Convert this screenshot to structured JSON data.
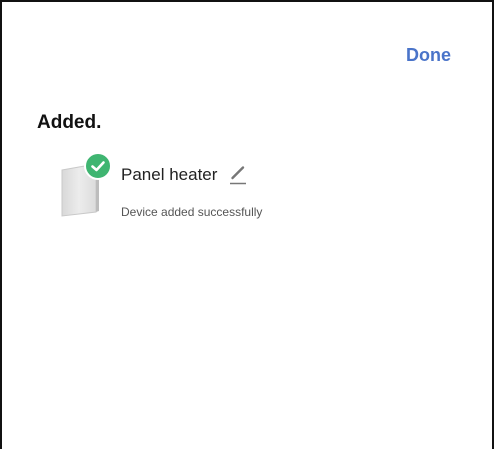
{
  "header": {
    "done_label": "Done"
  },
  "main": {
    "title": "Added.",
    "devices": [
      {
        "name": "Panel heater",
        "status": "Device added successfully",
        "thumbnail_icon": "panel-heater-image",
        "badge_icon": "check-circle-icon",
        "edit_icon": "pencil-icon"
      }
    ]
  },
  "colors": {
    "accent": "#4a74c9",
    "success": "#3fb571",
    "text_primary": "#111111",
    "text_secondary": "#555555"
  }
}
